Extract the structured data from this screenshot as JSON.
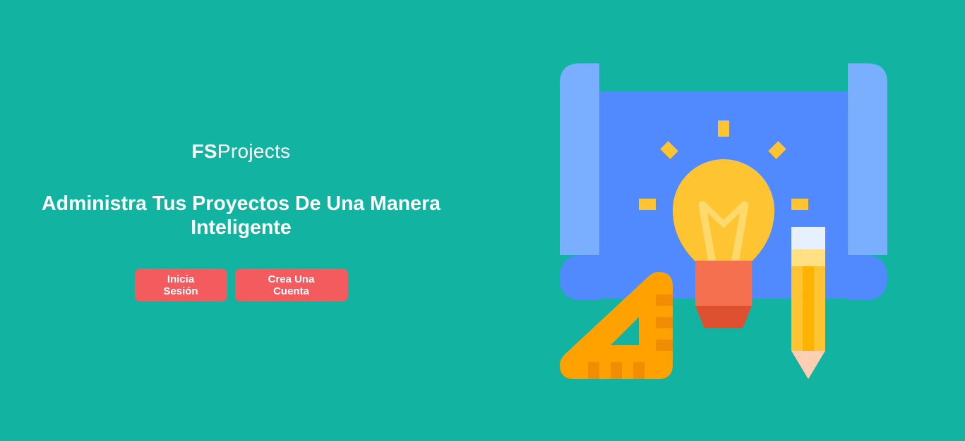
{
  "brand": {
    "bold": "FS",
    "light": "Projects"
  },
  "hero": {
    "headline_line1": "Administra Tus Proyectos De Una Manera",
    "headline_line2": "Inteligente"
  },
  "actions": {
    "login_label": "Inicia Sesión",
    "signup_label": "Crea Una Cuenta"
  },
  "colors": {
    "background": "#12b3a0",
    "button": "#f45b5f",
    "blueprint_light": "#7aaeff",
    "blueprint_dark": "#5189ff",
    "bulb": "#ffc432",
    "bulb_base": "#f4704f",
    "ruler": "#ffa200",
    "pencil": "#ffc432"
  },
  "illustration": {
    "icon": "idea-blueprint-illustration"
  }
}
